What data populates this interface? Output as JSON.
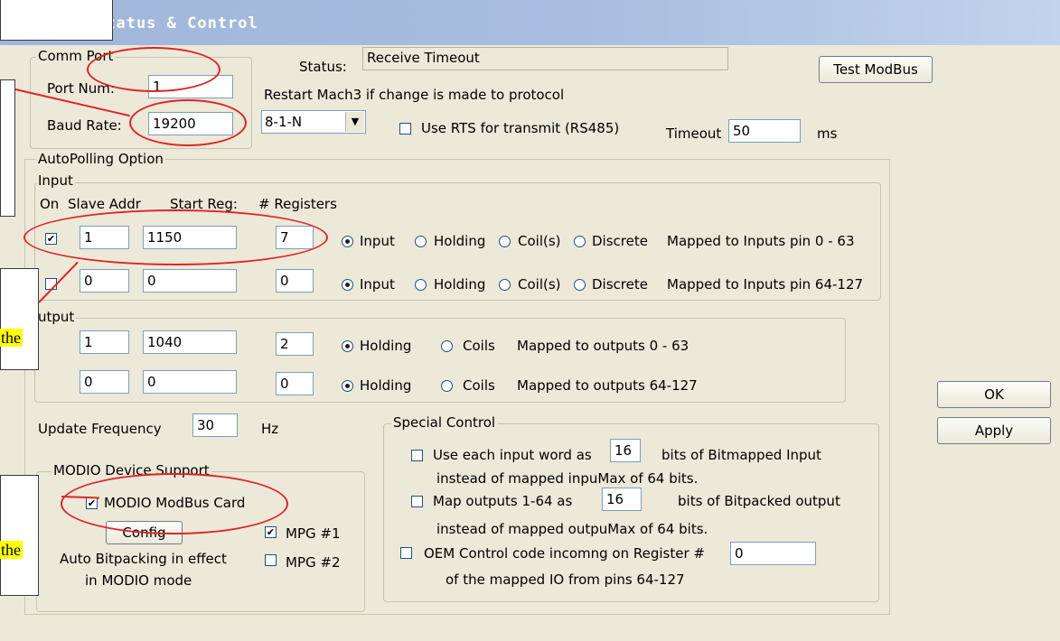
{
  "window": {
    "title": "Status & Control"
  },
  "comm_port": {
    "legend": "Comm Port",
    "port_label": "Port Num:",
    "port_value": "1",
    "baud_label": "Baud Rate:",
    "baud_value": "19200"
  },
  "status": {
    "label": "Status:",
    "value": "Receive Timeout",
    "test_button": "Test ModBus",
    "restart_note": "Restart Mach3 if change is made to protocol",
    "protocol_value": "8-1-N",
    "rts_label": "Use RTS for transmit (RS485)",
    "timeout_label": "Timeout",
    "timeout_value": "50",
    "timeout_unit": "ms"
  },
  "autopolling": {
    "legend": "AutoPolling Option",
    "input": {
      "legend": "Input",
      "headers": {
        "on": "On",
        "slave": "Slave Addr",
        "start": "Start Reg:",
        "count": "# Registers"
      },
      "rows": [
        {
          "on": true,
          "slave": "1",
          "start": "1150",
          "count": "7",
          "map": "Mapped to Inputs pin 0 - 63"
        },
        {
          "on": false,
          "slave": "0",
          "start": "0",
          "count": "0",
          "map": "Mapped to Inputs pin 64-127"
        }
      ],
      "radio_labels": {
        "input": "Input",
        "holding": "Holding",
        "coils": "Coil(s)",
        "discrete": "Discrete"
      }
    },
    "output": {
      "legend": "utput",
      "rows": [
        {
          "slave": "1",
          "start": "1040",
          "count": "2",
          "map": "Mapped to outputs 0 - 63"
        },
        {
          "slave": "0",
          "start": "0",
          "count": "0",
          "map": "Mapped to outputs 64-127"
        }
      ],
      "radio_labels": {
        "holding": "Holding",
        "coils": "Coils"
      }
    },
    "update": {
      "label": "Update Frequency",
      "value": "30",
      "unit": "Hz"
    }
  },
  "modio": {
    "legend": "MODIO Device Support",
    "card_label": "MODIO ModBus Card",
    "config_button": "Config",
    "mpg1": "MPG #1",
    "mpg2": "MPG #2",
    "note_line1": "Auto Bitpacking in effect",
    "note_line2": "in MODIO mode"
  },
  "special": {
    "legend": "Special Control",
    "row1_pre": "Use each input word as",
    "row1_value": "16",
    "row1_post": "bits of Bitmapped Input",
    "row1_sub": "instead of mapped inpuMax of 64 bits.",
    "row2_pre": "Map outputs 1-64 as",
    "row2_value": "16",
    "row2_post": "bits of Bitpacked output",
    "row2_sub": "instead of mapped outpuMax of 64 bits.",
    "row3_pre": "OEM Control code incomng on Register #",
    "row3_value": "0",
    "row3_sub": "of the mapped IO from pins 64-127"
  },
  "buttons": {
    "ok": "OK",
    "apply": "Apply"
  },
  "annotations": {
    "note1": "the",
    "note2": "the"
  }
}
